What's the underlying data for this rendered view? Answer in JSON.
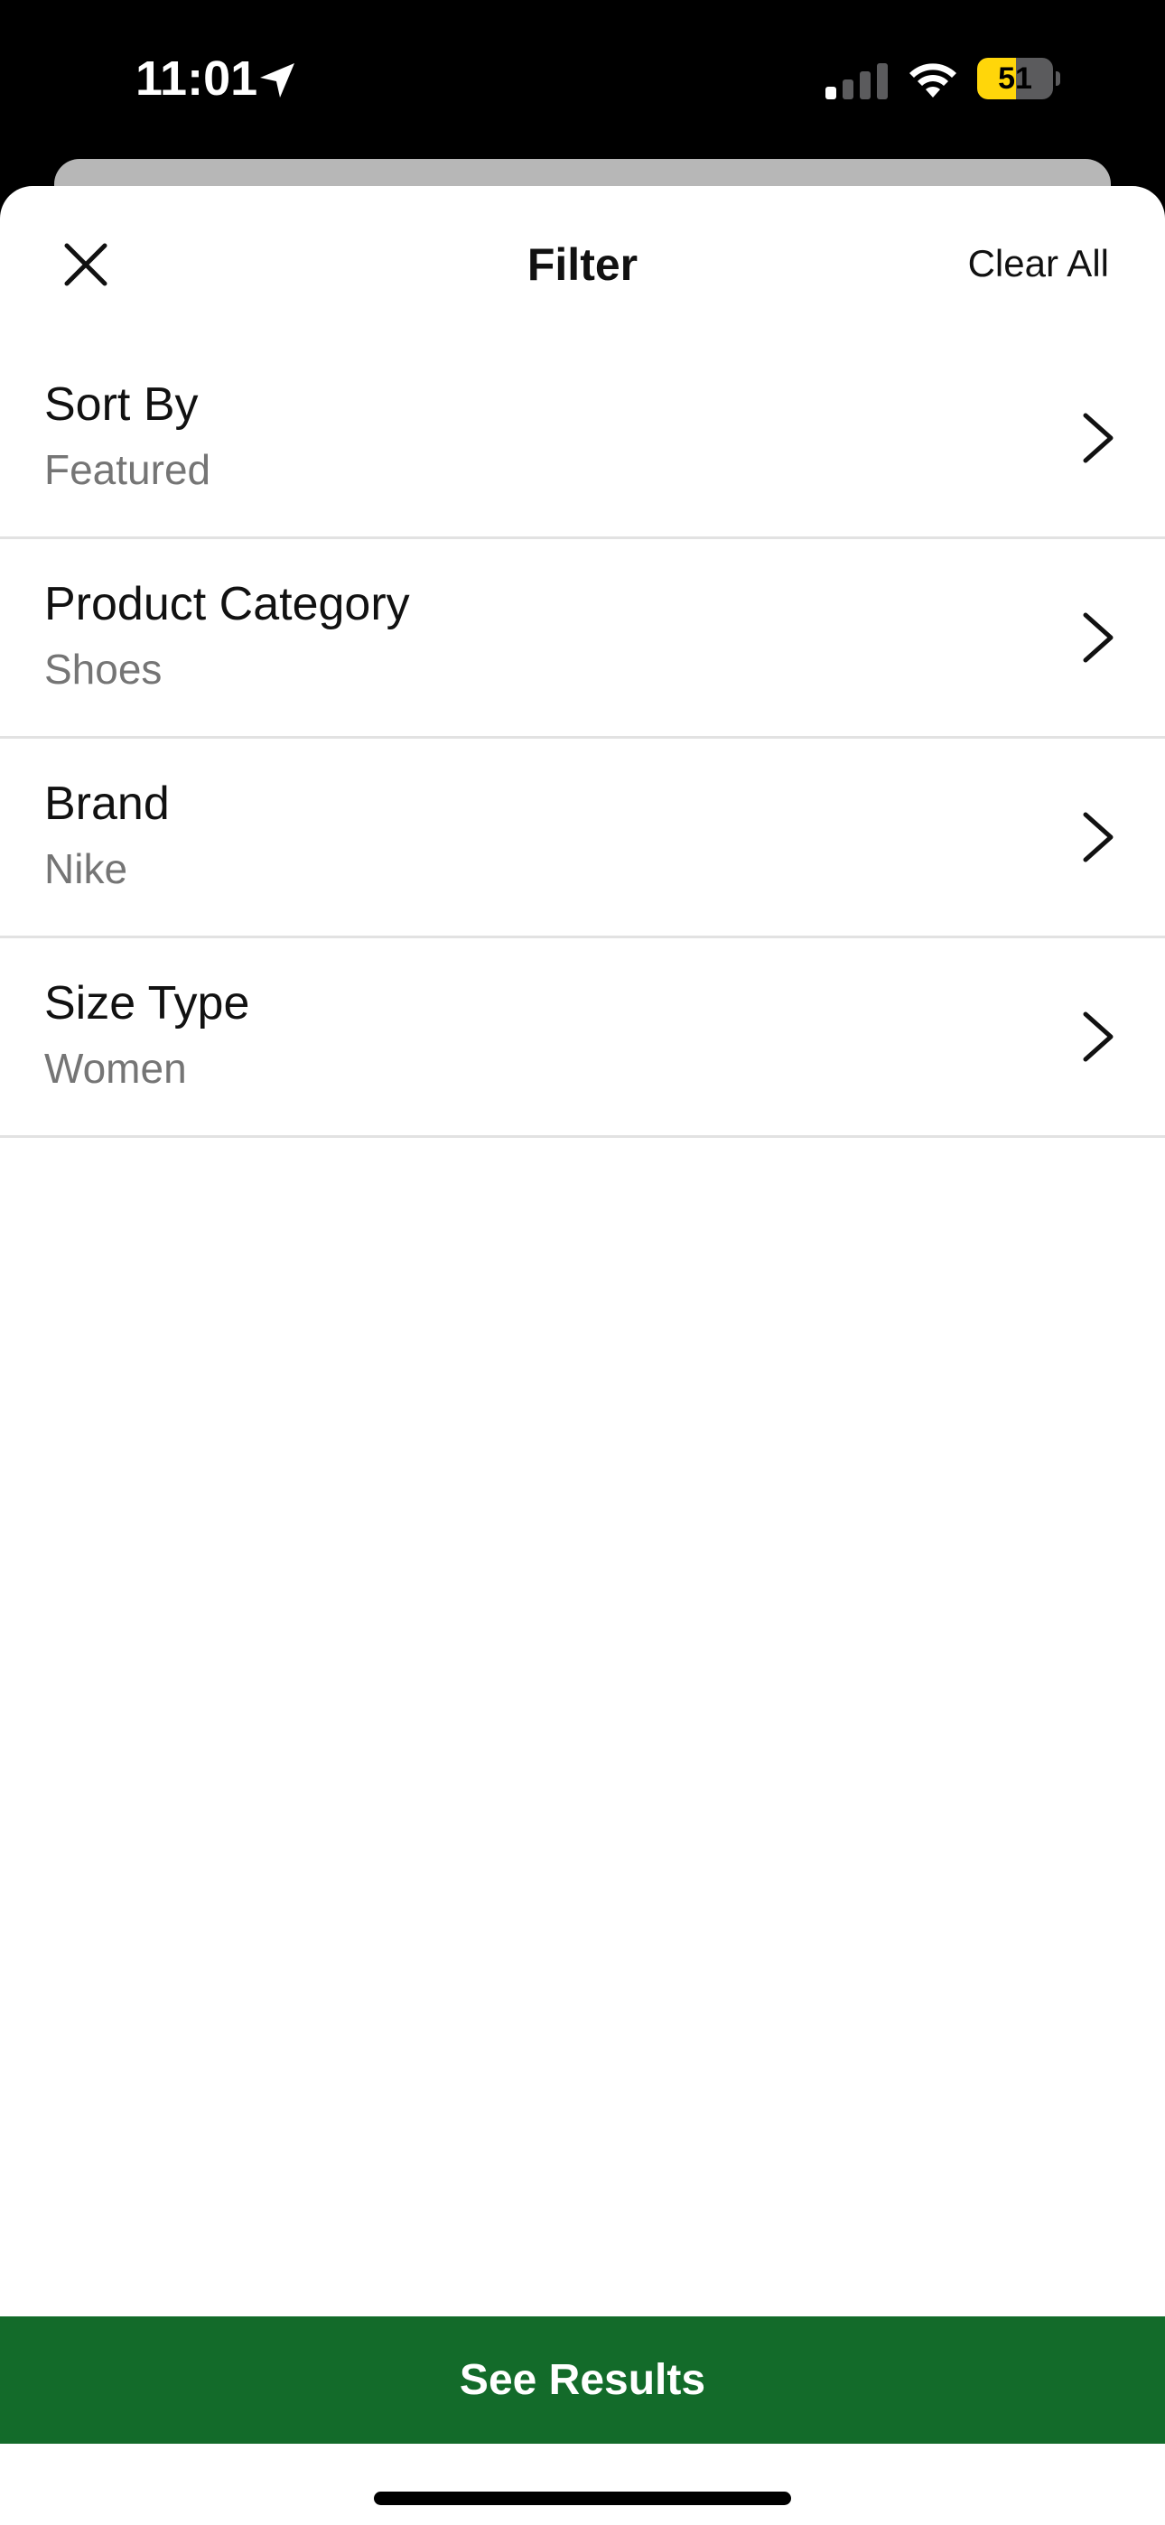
{
  "status_bar": {
    "time": "11:01",
    "battery_percent": "51",
    "battery_level": 0.51,
    "location_icon": "location-arrow-icon",
    "signal_icon": "cellular-signal-icon",
    "wifi_icon": "wifi-icon",
    "battery_color": "#ffd60a"
  },
  "header": {
    "title": "Filter",
    "clear_all_label": "Clear All",
    "close_icon": "close-icon"
  },
  "filters": [
    {
      "label": "Sort By",
      "value": "Featured"
    },
    {
      "label": "Product Category",
      "value": "Shoes"
    },
    {
      "label": "Brand",
      "value": "Nike"
    },
    {
      "label": "Size Type",
      "value": "Women"
    }
  ],
  "footer": {
    "see_results_label": "See Results",
    "button_color": "#136b2a"
  }
}
